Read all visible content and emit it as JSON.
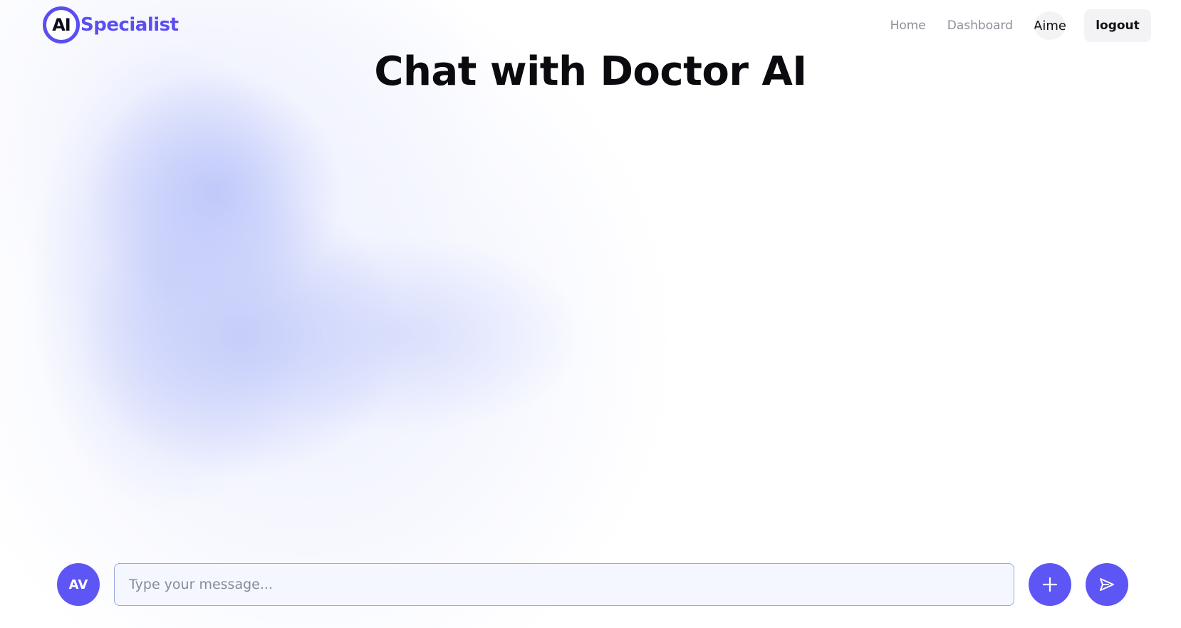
{
  "header": {
    "logo_badge": "AI",
    "logo_text": "Specialist",
    "nav": {
      "home": "Home",
      "dashboard": "Dashboard",
      "user_label": "Aime",
      "logout": "logout"
    }
  },
  "main": {
    "title": "Chat with Doctor AI"
  },
  "composer": {
    "avatar_initials": "AV",
    "placeholder": "Type your message...",
    "value": ""
  },
  "colors": {
    "accent": "#5e56f4",
    "brand": "#5b4ef0",
    "input_bg": "#f4f7ff",
    "input_border": "#9aa6e6"
  },
  "icons": {
    "add": "plus-icon",
    "send": "send-icon"
  }
}
